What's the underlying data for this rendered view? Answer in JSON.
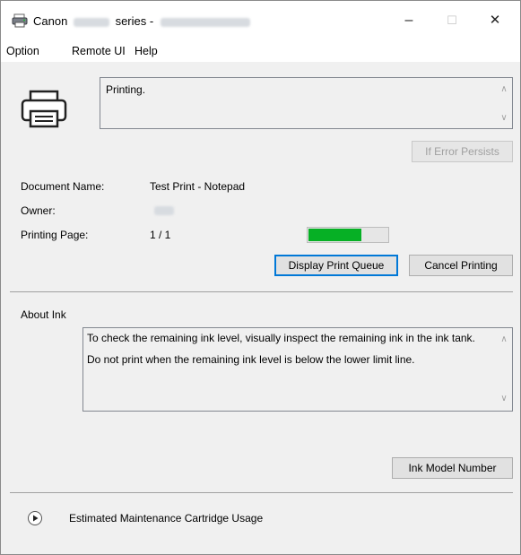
{
  "window": {
    "title_brand": "Canon",
    "title_series": "series -",
    "minimize_glyph": "–",
    "maximize_glyph": "☐",
    "close_glyph": "✕"
  },
  "menu": {
    "items": [
      "Option",
      "Remote UI",
      "Help"
    ]
  },
  "status": {
    "message": "Printing.",
    "error_button": "If Error Persists"
  },
  "document": {
    "name_label": "Document Name:",
    "name_value": "Test Print - Notepad",
    "owner_label": "Owner:",
    "page_label": "Printing Page:",
    "page_value": "1 / 1",
    "progress_fraction": 0.67
  },
  "actions": {
    "display_queue": "Display Print Queue",
    "cancel_printing": "Cancel Printing"
  },
  "ink": {
    "section_label": "About Ink",
    "paragraphs": [
      "To check the remaining ink level, visually inspect the remaining ink in the ink tank.",
      "Do not print when the remaining ink level is below the lower limit line."
    ],
    "model_button": "Ink Model Number"
  },
  "maintenance": {
    "label": "Estimated Maintenance Cartridge Usage"
  },
  "colors": {
    "progress": "#06b025",
    "focus": "#0078d7"
  }
}
